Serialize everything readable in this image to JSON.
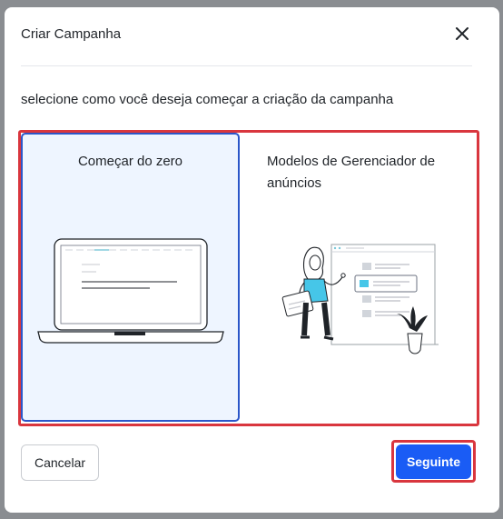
{
  "modal": {
    "title": "Criar Campanha",
    "close_icon": "close-icon",
    "subtitle": "selecione como você deseja começar a criação da campanha"
  },
  "options": {
    "scratch": {
      "label": "Começar do zero",
      "selected": true,
      "illustration": "laptop-illustration"
    },
    "templates": {
      "label": "Modelos de Gerenciador de anúncios",
      "selected": false,
      "illustration": "person-presenting-illustration"
    }
  },
  "footer": {
    "cancel_label": "Cancelar",
    "next_label": "Seguinte"
  },
  "colors": {
    "primary": "#1a5cf5",
    "selected_bg": "#eef5ff",
    "selected_border": "#2b56c9",
    "highlight": "#d9363e",
    "overlay": "#8a8d91"
  }
}
